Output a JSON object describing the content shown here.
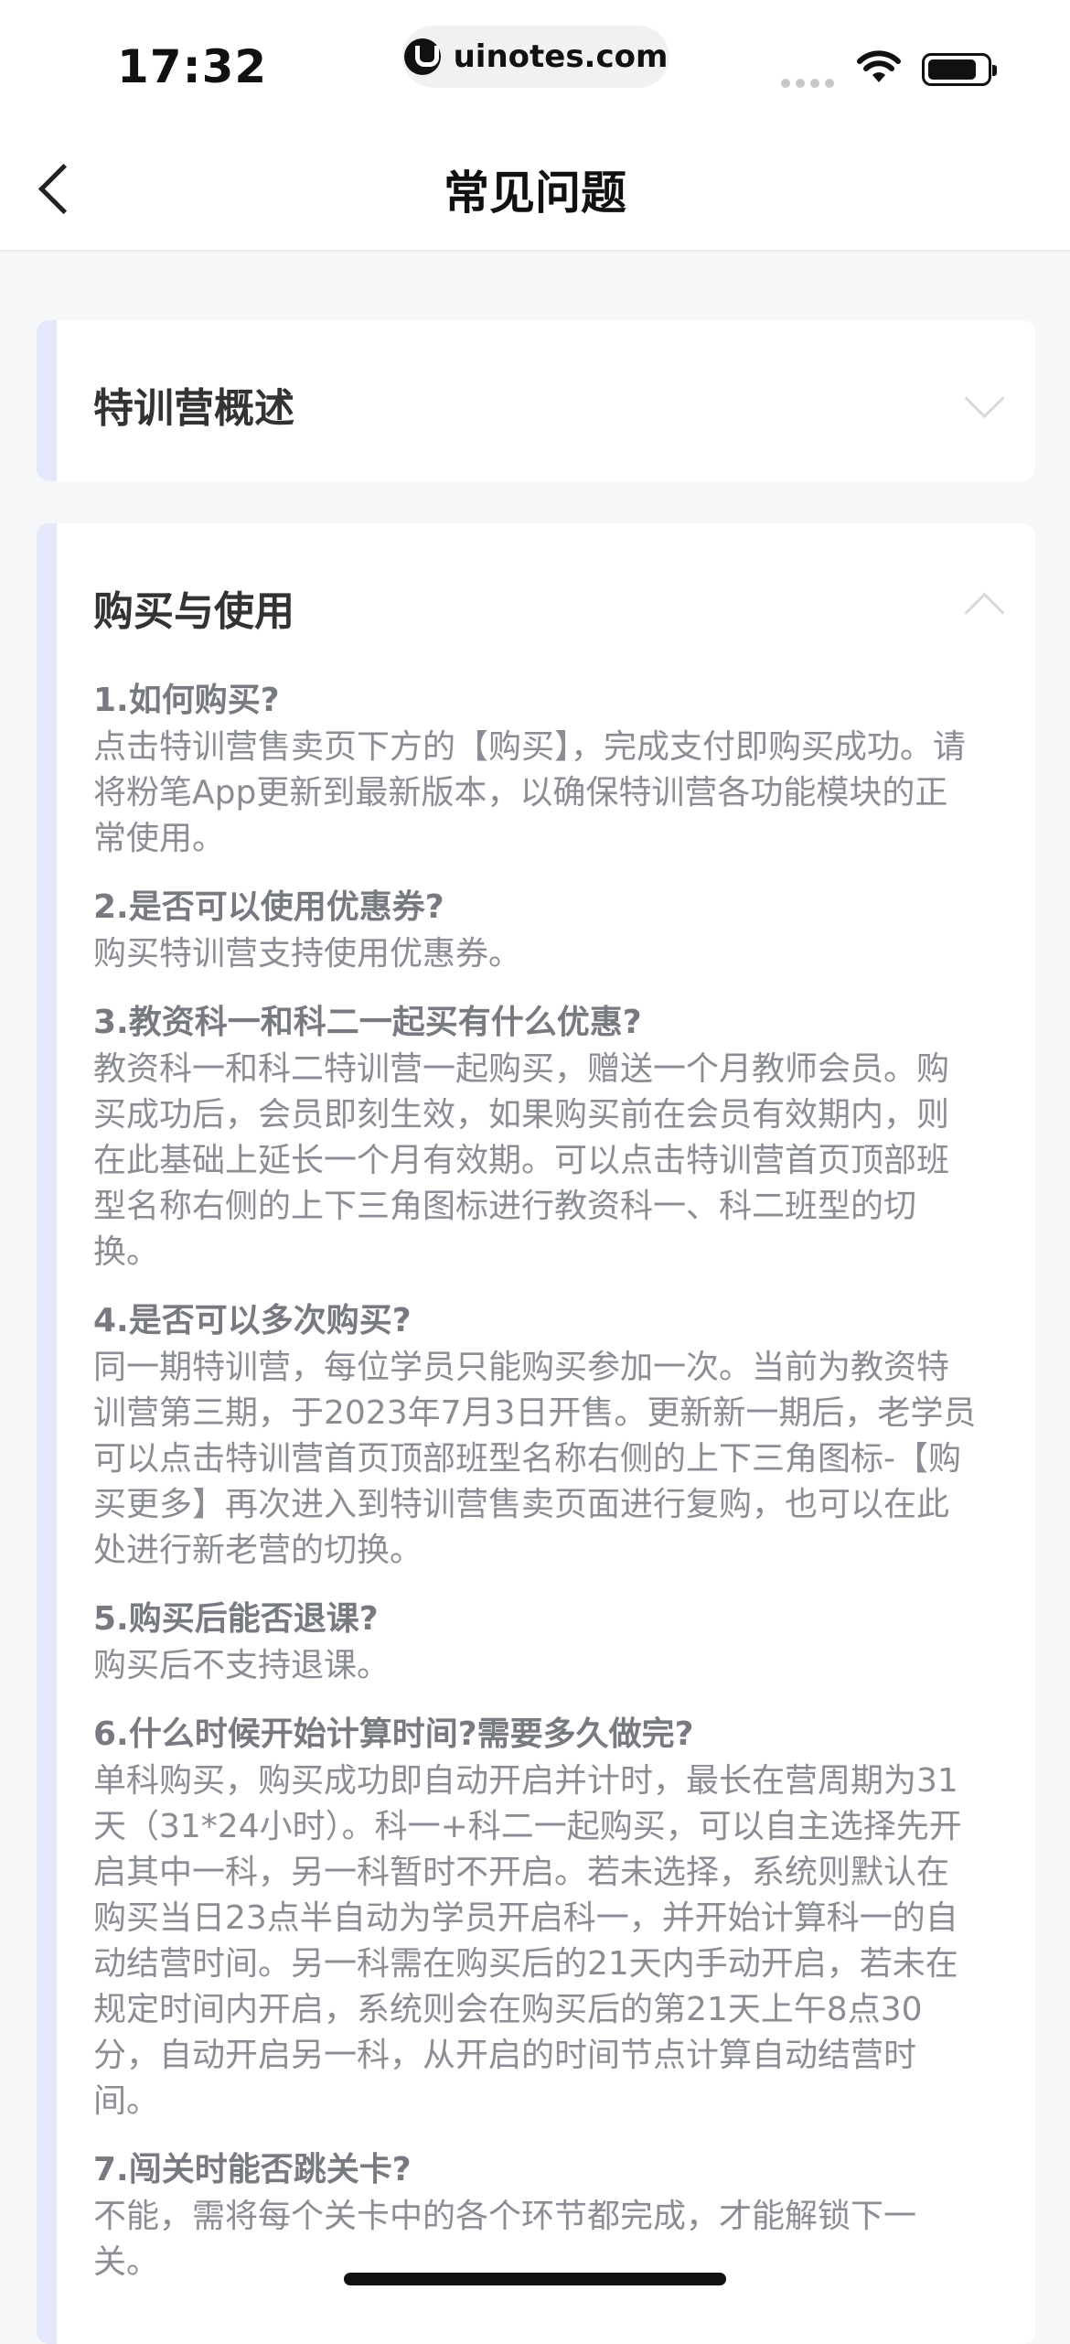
{
  "status_bar": {
    "time": "17:32",
    "url": "uinotes.com"
  },
  "nav": {
    "title": "常见问题"
  },
  "sections": [
    {
      "title": "特训营概述",
      "expanded": false
    },
    {
      "title": "购买与使用",
      "expanded": true,
      "faqs": [
        {
          "q": "1.如何购买?",
          "a": "点击特训营售卖页下方的【购买】，完成支付即购买成功。请将粉笔App更新到最新版本，以确保特训营各功能模块的正常使用。"
        },
        {
          "q": "2.是否可以使用优惠券?",
          "a": "购买特训营支持使用优惠券。"
        },
        {
          "q": "3.教资科一和科二一起买有什么优惠?",
          "a": "教资科一和科二特训营一起购买，赠送一个月教师会员。购买成功后，会员即刻生效，如果购买前在会员有效期内，则在此基础上延长一个月有效期。可以点击特训营首页顶部班型名称右侧的上下三角图标进行教资科一、科二班型的切换。"
        },
        {
          "q": "4.是否可以多次购买?",
          "a": "同一期特训营，每位学员只能购买参加一次。当前为教资特训营第三期，于2023年7月3日开售。更新新一期后，老学员可以点击特训营首页顶部班型名称右侧的上下三角图标-【购买更多】再次进入到特训营售卖页面进行复购，也可以在此处进行新老营的切换。"
        },
        {
          "q": "5.购买后能否退课?",
          "a": "购买后不支持退课。"
        },
        {
          "q": "6.什么时候开始计算时间?需要多久做完?",
          "a": "单科购买，购买成功即自动开启并计时，最长在营周期为31天（31*24小时）。科一+科二一起购买，可以自主选择先开启其中一科，另一科暂时不开启。若未选择，系统则默认在购买当日23点半自动为学员开启科一，并开始计算科一的自动结营时间。另一科需在购买后的21天内手动开启，若未在规定时间内开启，系统则会在购买后的第21天上午8点30分，自动开启另一科，从开启的时间节点计算自动结营时间。"
        },
        {
          "q": "7.闯关时能否跳关卡?",
          "a": "不能，需将每个关卡中的各个环节都完成，才能解锁下一关。"
        }
      ]
    }
  ]
}
